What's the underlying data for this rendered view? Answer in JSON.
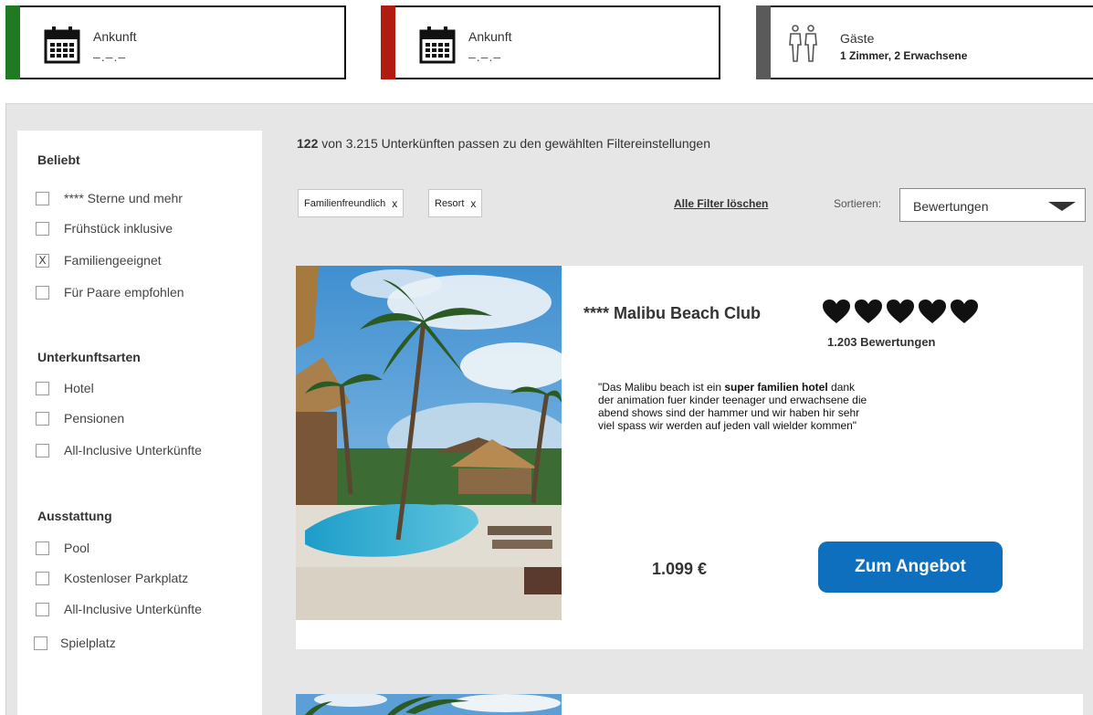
{
  "search": {
    "arrival1": {
      "label": "Ankunft",
      "value": "–.–.–",
      "accent": "#1f7a22"
    },
    "arrival2": {
      "label": "Ankunft",
      "value": "–.–.–",
      "accent": "#b01c10"
    },
    "guests": {
      "label": "Gäste",
      "value": "1 Zimmer, 2 Erwachsene",
      "accent": "#5a5a5a"
    }
  },
  "sidebar": {
    "sections": [
      {
        "title": "Beliebt",
        "options": [
          {
            "label": "**** Sterne und mehr",
            "checked": false
          },
          {
            "label": "Frühstück inklusive",
            "checked": false
          },
          {
            "label": "Familiengeeignet",
            "checked": true
          },
          {
            "label": "Für Paare empfohlen",
            "checked": false
          }
        ]
      },
      {
        "title": "Unterkunftsarten",
        "options": [
          {
            "label": "Hotel",
            "checked": false
          },
          {
            "label": "Pensionen",
            "checked": false
          },
          {
            "label": "All-Inclusive Unterkünfte",
            "checked": false
          }
        ]
      },
      {
        "title": "Ausstattung",
        "options": [
          {
            "label": "Pool",
            "checked": false
          },
          {
            "label": "Kostenloser Parkplatz",
            "checked": false
          },
          {
            "label": "All-Inclusive Unterkünfte",
            "checked": false
          },
          {
            "label": "Spielplatz",
            "checked": false
          }
        ]
      }
    ],
    "checked_mark": "X"
  },
  "results": {
    "summary_count": "122",
    "summary_text": " von 3.215 Unterkünften passen zu den gewählten Filtereinstellungen",
    "chips": [
      {
        "label": "Familienfreundlich",
        "remove": "x"
      },
      {
        "label": "Resort",
        "remove": "x"
      }
    ],
    "clear_filters": "Alle Filter löschen",
    "sort_label": "Sortieren:",
    "sort_value": "Bewertungen"
  },
  "card": {
    "name": "**** Malibu Beach Club",
    "rating_hearts": 5,
    "reviews": "1.203 Bewertungen",
    "quote_parts": [
      {
        "text": "\"Das Malibu beach ist ein ",
        "bold": false
      },
      {
        "text": "super familien hotel",
        "bold": true
      },
      {
        "text": " dank der animation fuer kinder teenager und erwachsene die abend shows sind der hammer und wir haben hir sehr viel spass wir werden auf jeden vall wielder kommen\"",
        "bold": false
      }
    ],
    "price": "1.099 €",
    "cta": "Zum Angebot",
    "cta_color": "#0f6fbf"
  },
  "icons": {
    "calendar": "calendar-icon",
    "guests": "guests-icon",
    "heart": "heart-icon",
    "dropdown": "chevron-down-icon"
  }
}
